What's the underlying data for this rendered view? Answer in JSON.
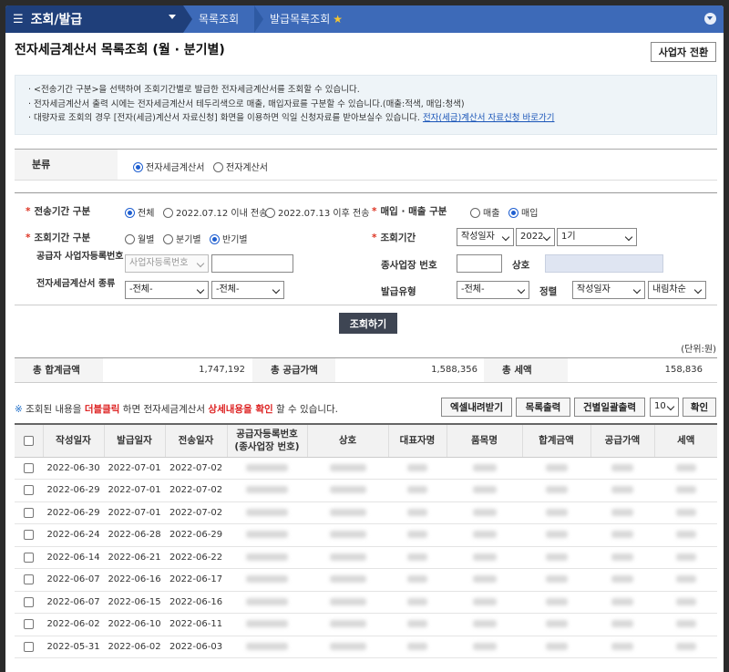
{
  "nav": {
    "menu_title": "조회/발급",
    "crumb1": "목록조회",
    "crumb2": "발급목록조회"
  },
  "page_title": "전자세금계산서 목록조회 (월 · 분기별)",
  "business_switch_button": "사업자 전환",
  "info": {
    "line1": "· <전송기간 구분>을 선택하여 조회기간별로 발급한 전자세금계산서를 조회할 수 있습니다.",
    "line2": "· 전자세금계산서 출력 시에는 전자세금계산서 테두리색으로 매출, 매입자료를 구분할 수 있습니다.(매출:적색, 매입:청색)",
    "line3": "· 대량자료 조회의 경우 [전자(세금)계산서 자료신청] 화면을 이용하면 익일 신청자료를 받아보실수 있습니다.",
    "line3_link": "전자(세금)계산서 자료신청 바로가기"
  },
  "classification": {
    "label": "분류",
    "options": [
      "전자세금계산서",
      "전자계산서"
    ],
    "selected": "전자세금계산서"
  },
  "search": {
    "transmit_period_label": "전송기간 구분",
    "transmit_options": [
      "전체",
      "2022.07.12 이내 전송",
      "2022.07.13 이후 전송"
    ],
    "transmit_selected": "전체",
    "trade_type_label": "매입 · 매출 구분",
    "trade_options": [
      "매출",
      "매입"
    ],
    "trade_selected": "매입",
    "period_type_label": "조회기간 구분",
    "period_options": [
      "월별",
      "분기별",
      "반기별"
    ],
    "period_selected": "반기별",
    "period_label": "조회기간",
    "date_basis": "작성일자",
    "year": "2022",
    "half": "1기",
    "supplier_reg_label": "공급자 사업자등록번호",
    "supplier_reg_placeholder": "사업자등록번호",
    "branch_no_label": "종사업장 번호",
    "company_label": "상호",
    "invoice_kind_label": "전자세금계산서 종류",
    "invoice_kind_1": "-전체-",
    "invoice_kind_2": "-전체-",
    "issue_type_label": "발급유형",
    "issue_type": "-전체-",
    "sort_label": "정렬",
    "sort_by": "작성일자",
    "sort_order": "내림차순",
    "submit": "조회하기"
  },
  "unit_label": "(단위:원)",
  "totals": {
    "sum_label": "총 합계금액",
    "sum_value": "1,747,192",
    "supply_label": "총 공급가액",
    "supply_value": "1,588,356",
    "tax_label": "총 세액",
    "tax_value": "158,836"
  },
  "notice": {
    "mark": "※",
    "text1": "조회된 내용을",
    "emph1": "더블클릭",
    "text2": "하면 전자세금계산서",
    "emph2": "상세내용을 확인",
    "text3": "할 수 있습니다."
  },
  "grid_buttons": {
    "excel": "엑셀내려받기",
    "print_list": "목록출력",
    "print_each": "건별일괄출력",
    "page_size": "10",
    "confirm": "확인"
  },
  "table": {
    "headers": [
      "작성일자",
      "발급일자",
      "전송일자",
      "공급자등록번호\n(종사업장 번호)",
      "상호",
      "대표자명",
      "품목명",
      "합계금액",
      "공급가액",
      "세액"
    ],
    "rows": [
      [
        "2022-06-30",
        "2022-07-01",
        "2022-07-02"
      ],
      [
        "2022-06-29",
        "2022-07-01",
        "2022-07-02"
      ],
      [
        "2022-06-29",
        "2022-07-01",
        "2022-07-02"
      ],
      [
        "2022-06-24",
        "2022-06-28",
        "2022-06-29"
      ],
      [
        "2022-06-14",
        "2022-06-21",
        "2022-06-22"
      ],
      [
        "2022-06-07",
        "2022-06-16",
        "2022-06-17"
      ],
      [
        "2022-06-07",
        "2022-06-15",
        "2022-06-16"
      ],
      [
        "2022-06-02",
        "2022-06-10",
        "2022-06-11"
      ],
      [
        "2022-05-31",
        "2022-06-02",
        "2022-06-03"
      ]
    ]
  }
}
